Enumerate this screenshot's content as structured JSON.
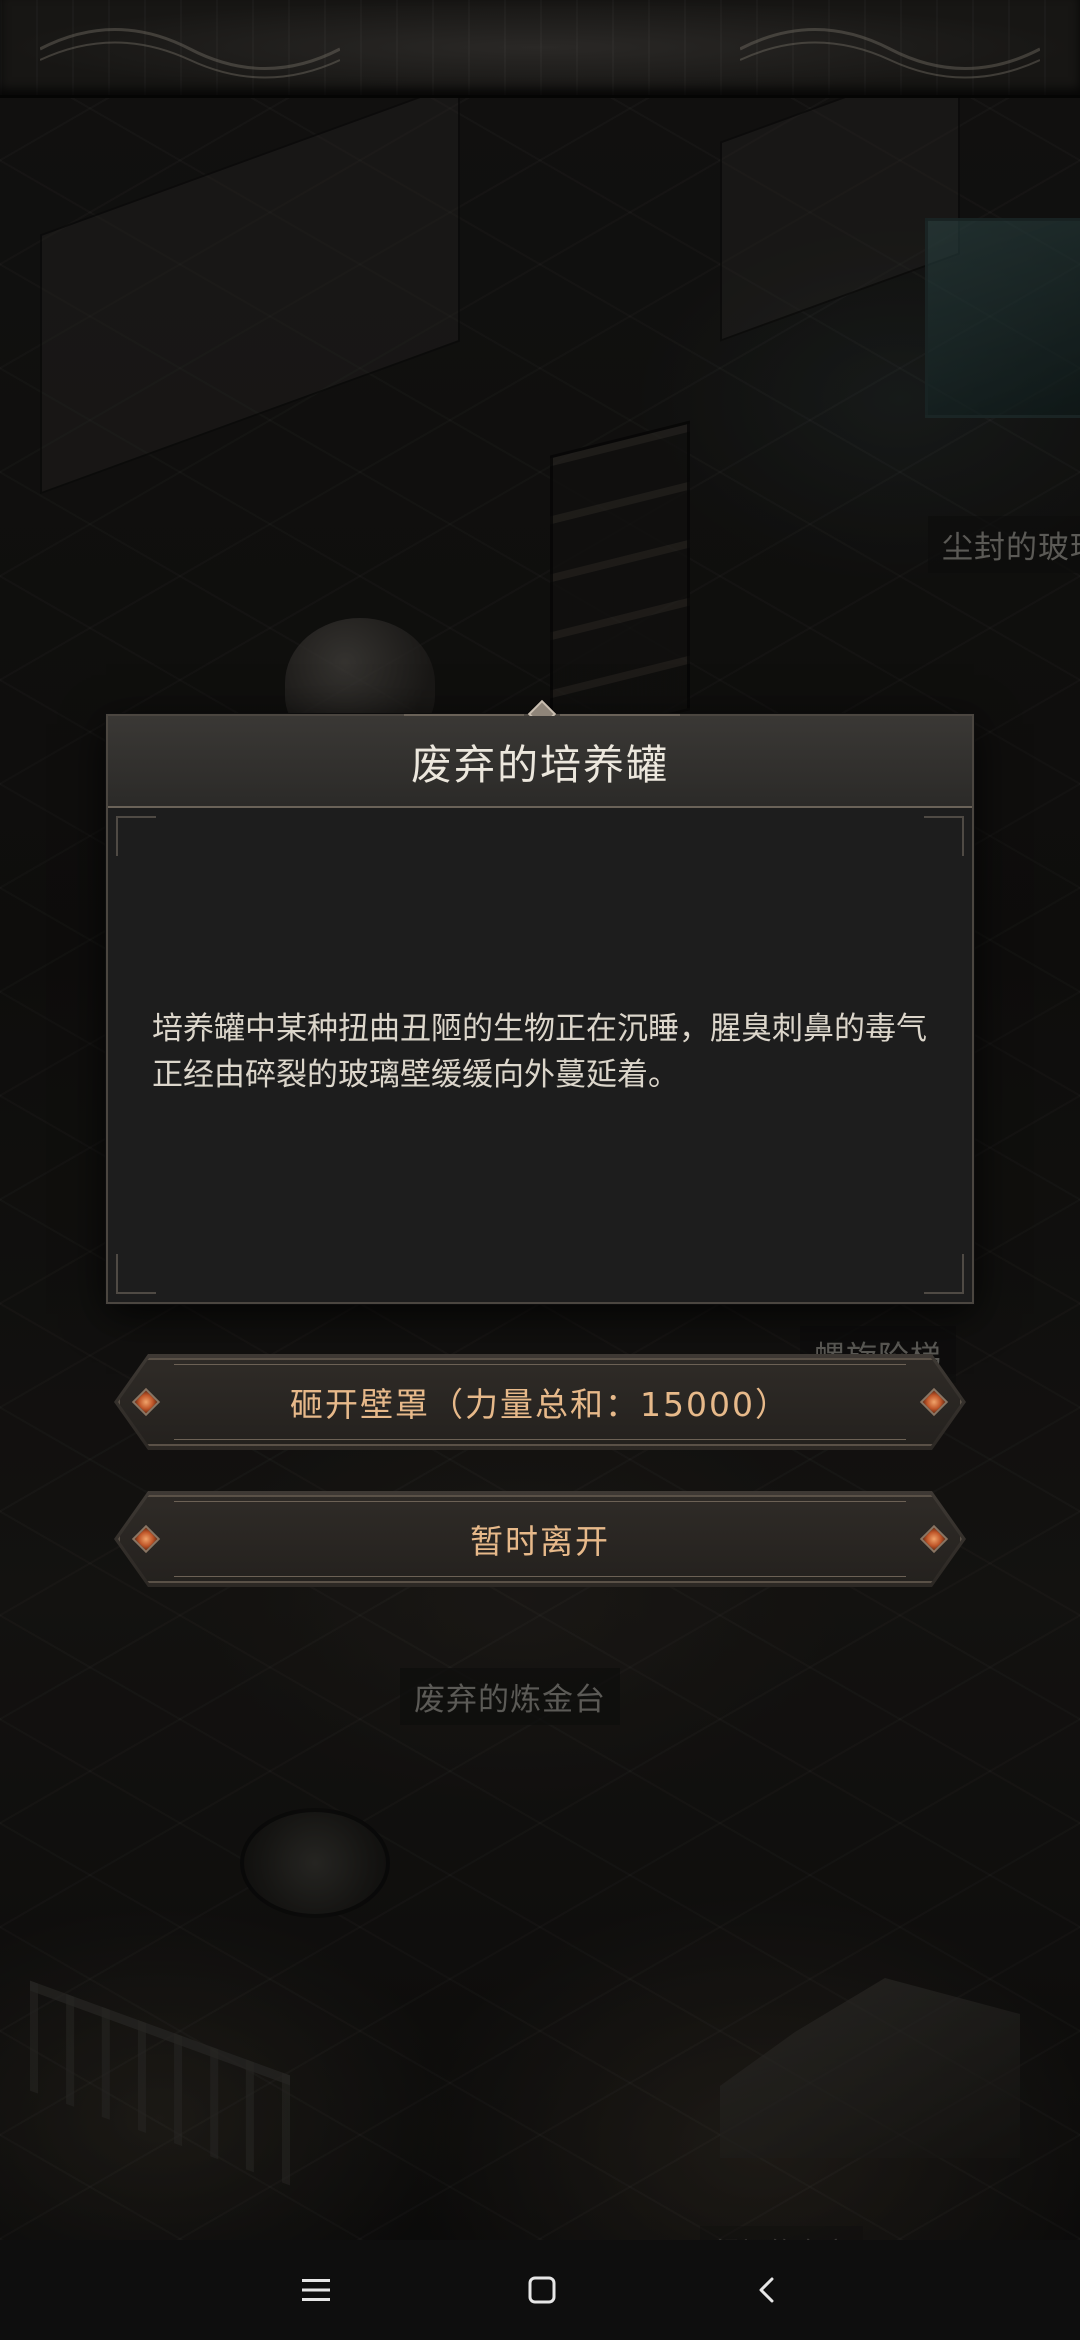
{
  "dialog": {
    "title": "废弃的培养罐",
    "body": "培养罐中某种扭曲丑陋的生物正在沉睡，腥臭刺鼻的毒气正经由碎裂的玻璃壁缓缓向外蔓延着。"
  },
  "actions": {
    "smash_label": "砸开壁罩（力量总和：15000）",
    "leave_label": "暂时离开"
  },
  "scene_labels": {
    "dusty_glass": "尘封的玻璃",
    "spiral_stairs": "螺旋阶梯",
    "alchemy_table": "废弃的炼金台",
    "bottom_partial": "绿褐的全座"
  },
  "nav_bar": {
    "menu_icon": "menu-icon",
    "home_icon": "home-icon",
    "back_icon": "back-icon"
  },
  "colors": {
    "button_text": "#e7b98a",
    "gem": "#c0572a",
    "dialog_bg": "#1d1d1d"
  }
}
